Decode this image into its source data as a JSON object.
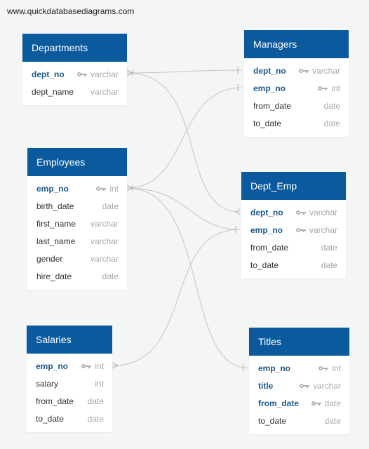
{
  "watermark": "www.quickdatabasediagrams.com",
  "colors": {
    "header": "#0b5a9d",
    "pk_text": "#1c5a8e",
    "type_text": "#a8a8a8",
    "link": "#c4c4c4"
  },
  "tables": {
    "departments": {
      "name": "Departments",
      "fields": [
        {
          "name": "dept_no",
          "type": "varchar",
          "pk": true,
          "key_icon": "key-icon"
        },
        {
          "name": "dept_name",
          "type": "varchar",
          "pk": false
        }
      ]
    },
    "managers": {
      "name": "Managers",
      "fields": [
        {
          "name": "dept_no",
          "type": "varchar",
          "pk": true,
          "key_icon": "key-icon"
        },
        {
          "name": "emp_no",
          "type": "int",
          "pk": true,
          "key_icon": "key-icon"
        },
        {
          "name": "from_date",
          "type": "date",
          "pk": false
        },
        {
          "name": "to_date",
          "type": "date",
          "pk": false
        }
      ]
    },
    "employees": {
      "name": "Employees",
      "fields": [
        {
          "name": "emp_no",
          "type": "int",
          "pk": true,
          "key_icon": "key-icon"
        },
        {
          "name": "birth_date",
          "type": "date",
          "pk": false
        },
        {
          "name": "first_name",
          "type": "varchar",
          "pk": false
        },
        {
          "name": "last_name",
          "type": "varchar",
          "pk": false
        },
        {
          "name": "gender",
          "type": "varchar",
          "pk": false
        },
        {
          "name": "hire_date",
          "type": "date",
          "pk": false
        }
      ]
    },
    "dept_emp": {
      "name": "Dept_Emp",
      "fields": [
        {
          "name": "dept_no",
          "type": "varchar",
          "pk": true,
          "key_icon": "key-icon"
        },
        {
          "name": "emp_no",
          "type": "varchar",
          "pk": true,
          "key_icon": "key-icon"
        },
        {
          "name": "from_date",
          "type": "date",
          "pk": false
        },
        {
          "name": "to_date",
          "type": "date",
          "pk": false
        }
      ]
    },
    "salaries": {
      "name": "Salaries",
      "fields": [
        {
          "name": "emp_no",
          "type": "int",
          "pk": true,
          "key_icon": "key-icon"
        },
        {
          "name": "salary",
          "type": "int",
          "pk": false
        },
        {
          "name": "from_date",
          "type": "date",
          "pk": false
        },
        {
          "name": "to_date",
          "type": "date",
          "pk": false
        }
      ]
    },
    "titles": {
      "name": "Titles",
      "fields": [
        {
          "name": "emp_no",
          "type": "int",
          "pk": true,
          "key_icon": "key-icon"
        },
        {
          "name": "title",
          "type": "varchar",
          "pk": true,
          "key_icon": "key-icon"
        },
        {
          "name": "from_date",
          "type": "date",
          "pk": true,
          "key_icon": "key-icon"
        },
        {
          "name": "to_date",
          "type": "date",
          "pk": false
        }
      ]
    }
  }
}
